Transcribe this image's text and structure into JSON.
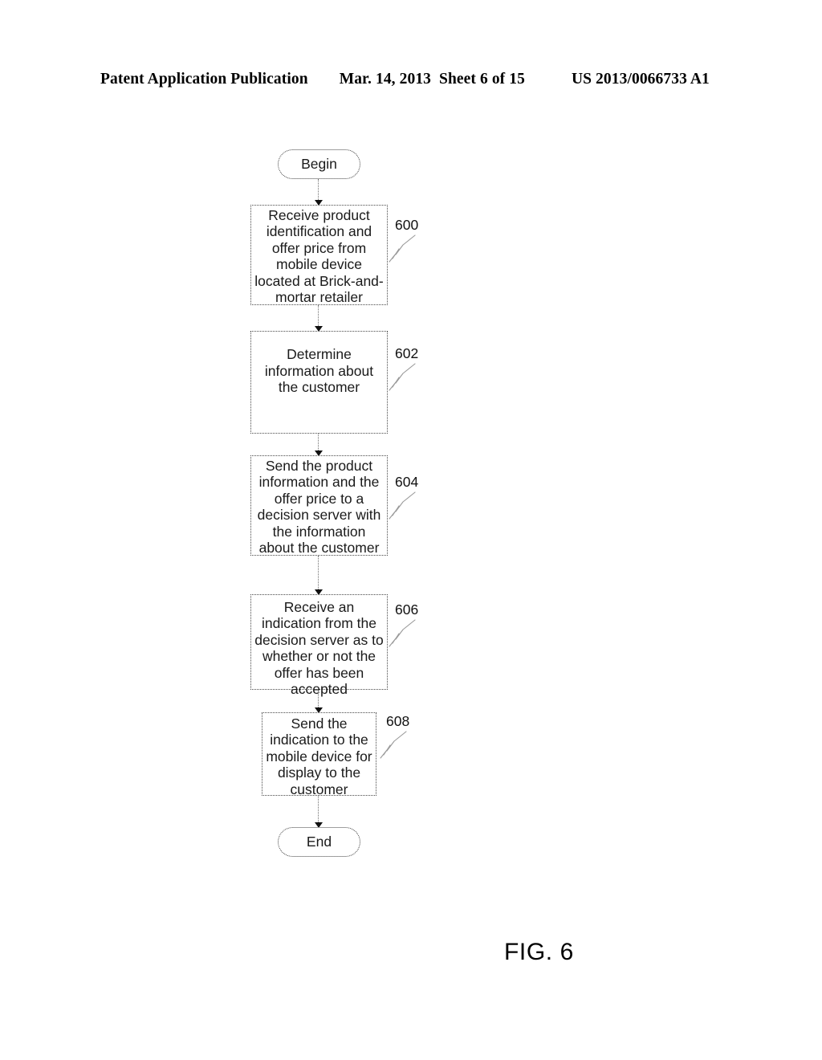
{
  "header": {
    "publication": "Patent Application Publication",
    "date": "Mar. 14, 2013",
    "sheet": "Sheet 6 of 15",
    "patent_number": "US 2013/0066733 A1"
  },
  "figure": {
    "caption": "FIG. 6",
    "type": "flowchart"
  },
  "flowchart": {
    "start": {
      "label": "Begin"
    },
    "end": {
      "label": "End"
    },
    "steps": [
      {
        "ref": "600",
        "text": "Receive product identification and offer price from mobile device located at Brick-and-mortar retailer"
      },
      {
        "ref": "602",
        "text": "Determine information about the customer"
      },
      {
        "ref": "604",
        "text": "Send the product information and the offer price to a decision server with the information about the customer"
      },
      {
        "ref": "606",
        "text": "Receive an indication from the decision server as to whether or not the offer has been accepted"
      },
      {
        "ref": "608",
        "text": "Send the indication to the mobile device for display to the customer"
      }
    ]
  },
  "colors": {
    "ink": "#000000",
    "box_border": "#4a4a4a",
    "connector": "#6f6f6f",
    "leader": "#9a9a9a",
    "background": "#ffffff"
  }
}
